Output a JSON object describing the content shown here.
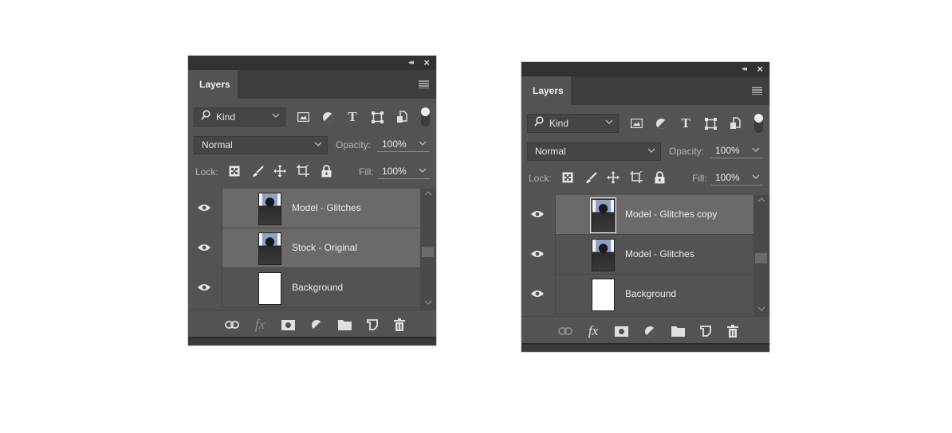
{
  "panels": [
    {
      "tab": "Layers",
      "filter": {
        "kind_label": "Kind"
      },
      "blend_mode": "Normal",
      "opacity_label": "Opacity:",
      "opacity_value": "100%",
      "lock_label": "Lock:",
      "fill_label": "Fill:",
      "fill_value": "100%",
      "layers": [
        {
          "name": "Model - Glitches",
          "selected": true,
          "thumb": "photo",
          "visible": true
        },
        {
          "name": "Stock - Original",
          "selected": true,
          "thumb": "photo",
          "visible": true
        },
        {
          "name": "Background",
          "selected": false,
          "thumb": "white",
          "visible": true
        }
      ]
    },
    {
      "tab": "Layers",
      "filter": {
        "kind_label": "Kind"
      },
      "blend_mode": "Normal",
      "opacity_label": "Opacity:",
      "opacity_value": "100%",
      "lock_label": "Lock:",
      "fill_label": "Fill:",
      "fill_value": "100%",
      "layers": [
        {
          "name": "Model - Glitches copy",
          "selected": true,
          "thumb": "photo",
          "visible": true
        },
        {
          "name": "Model - Glitches",
          "selected": false,
          "thumb": "photo",
          "visible": true
        },
        {
          "name": "Background",
          "selected": false,
          "thumb": "white",
          "visible": true
        }
      ]
    }
  ],
  "icons": {
    "collapse": "«",
    "close": "✕",
    "search": "⌕",
    "chevron": "⌄",
    "up": "︿",
    "down": "﹀"
  }
}
